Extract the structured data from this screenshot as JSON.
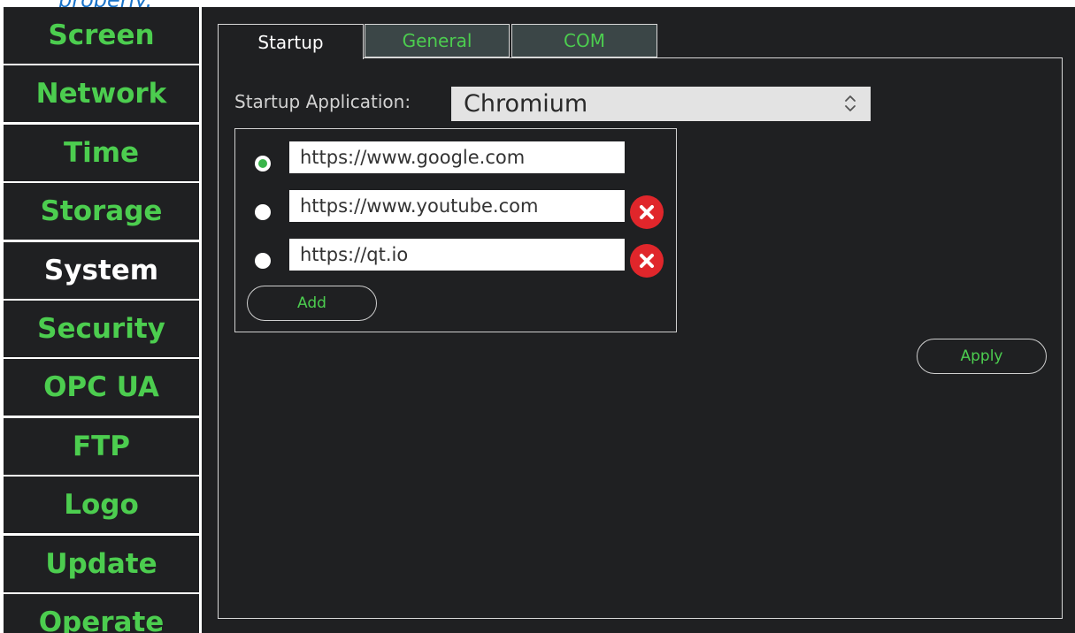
{
  "top_cut_text": "properly.",
  "sidebar": {
    "items": [
      {
        "label": "Screen",
        "active": false
      },
      {
        "label": "Network",
        "active": false
      },
      {
        "label": "Time",
        "active": false
      },
      {
        "label": "Storage",
        "active": false
      },
      {
        "label": "System",
        "active": true
      },
      {
        "label": "Security",
        "active": false
      },
      {
        "label": "OPC UA",
        "active": false
      },
      {
        "label": "FTP",
        "active": false
      },
      {
        "label": "Logo",
        "active": false
      },
      {
        "label": "Update",
        "active": false
      },
      {
        "label": "Operate",
        "active": false
      }
    ]
  },
  "tabs": [
    {
      "label": "Startup",
      "active": true
    },
    {
      "label": "General",
      "active": false
    },
    {
      "label": "COM",
      "active": false
    }
  ],
  "startup": {
    "app_label": "Startup Application:",
    "selected_app": "Chromium",
    "urls": [
      {
        "value": "https://www.google.com",
        "selected": true,
        "deletable": false
      },
      {
        "value": "https://www.youtube.com",
        "selected": false,
        "deletable": true
      },
      {
        "value": "https://qt.io",
        "selected": false,
        "deletable": true
      }
    ],
    "add_label": "Add",
    "apply_label": "Apply"
  },
  "colors": {
    "accent_green": "#4ccd4f",
    "background_dark": "#1f2022",
    "inactive_tab": "#3b4647",
    "delete_red": "#e0262b",
    "radio_selected": "#39b54a"
  }
}
